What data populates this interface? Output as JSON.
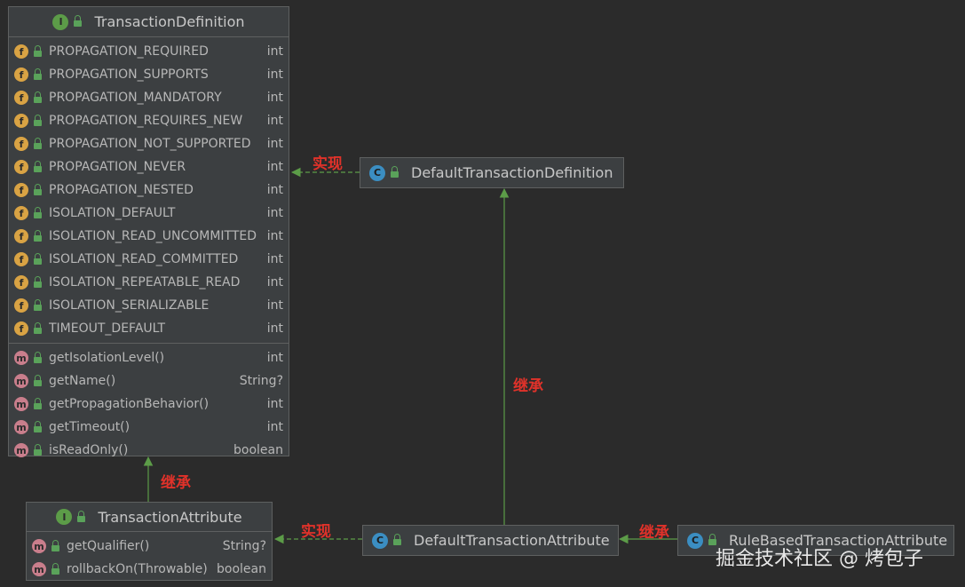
{
  "nodes": {
    "transaction_definition": {
      "kind": "I",
      "title": "TransactionDefinition",
      "fields": [
        {
          "name": "PROPAGATION_REQUIRED",
          "type": "int"
        },
        {
          "name": "PROPAGATION_SUPPORTS",
          "type": "int"
        },
        {
          "name": "PROPAGATION_MANDATORY",
          "type": "int"
        },
        {
          "name": "PROPAGATION_REQUIRES_NEW",
          "type": "int"
        },
        {
          "name": "PROPAGATION_NOT_SUPPORTED",
          "type": "int"
        },
        {
          "name": "PROPAGATION_NEVER",
          "type": "int"
        },
        {
          "name": "PROPAGATION_NESTED",
          "type": "int"
        },
        {
          "name": "ISOLATION_DEFAULT",
          "type": "int"
        },
        {
          "name": "ISOLATION_READ_UNCOMMITTED",
          "type": "int"
        },
        {
          "name": "ISOLATION_READ_COMMITTED",
          "type": "int"
        },
        {
          "name": "ISOLATION_REPEATABLE_READ",
          "type": "int"
        },
        {
          "name": "ISOLATION_SERIALIZABLE",
          "type": "int"
        },
        {
          "name": "TIMEOUT_DEFAULT",
          "type": "int"
        }
      ],
      "methods": [
        {
          "name": "getIsolationLevel()",
          "type": "int"
        },
        {
          "name": "getName()",
          "type": "String?"
        },
        {
          "name": "getPropagationBehavior()",
          "type": "int"
        },
        {
          "name": "getTimeout()",
          "type": "int"
        },
        {
          "name": "isReadOnly()",
          "type": "boolean"
        }
      ]
    },
    "default_transaction_definition": {
      "kind": "C",
      "title": "DefaultTransactionDefinition"
    },
    "transaction_attribute": {
      "kind": "I",
      "title": "TransactionAttribute",
      "methods": [
        {
          "name": "getQualifier()",
          "type": "String?"
        },
        {
          "name": "rollbackOn(Throwable)",
          "type": "boolean"
        }
      ]
    },
    "default_transaction_attribute": {
      "kind": "C",
      "title": "DefaultTransactionAttribute"
    },
    "rule_based_transaction_attribute": {
      "kind": "C",
      "title": "RuleBasedTransactionAttribute"
    }
  },
  "edge_labels": {
    "implements": "实现",
    "extends": "继承"
  },
  "icons": {
    "field": "f",
    "method": "m",
    "interface": "I",
    "class": "C"
  },
  "colors": {
    "background": "#2b2b2b",
    "box": "#3c3f41",
    "arrow": "#5c9c48",
    "label": "#e0322a"
  },
  "watermark": "掘金技术社区 @ 烤包子"
}
